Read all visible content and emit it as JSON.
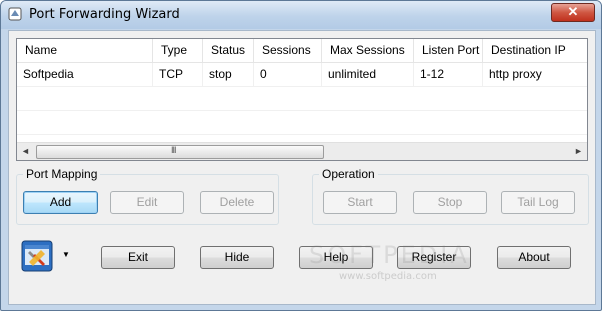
{
  "window": {
    "title": "Port Forwarding Wizard",
    "close_glyph": "✕"
  },
  "table": {
    "columns": [
      "Name",
      "Type",
      "Status",
      "Sessions",
      "Max Sessions",
      "Listen Port",
      "Destination IP"
    ],
    "rows": [
      [
        "Softpedia",
        "TCP",
        "stop",
        "0",
        "unlimited",
        "1-12",
        "http proxy"
      ]
    ],
    "scroll": {
      "left_arrow": "◄",
      "right_arrow": "►",
      "grip": "III"
    }
  },
  "port_mapping": {
    "label": "Port Mapping",
    "add": "Add",
    "edit": "Edit",
    "delete": "Delete"
  },
  "operation": {
    "label": "Operation",
    "start": "Start",
    "stop": "Stop",
    "tail_log": "Tail Log"
  },
  "bottom": {
    "dropdown_glyph": "▼",
    "exit": "Exit",
    "hide": "Hide",
    "help": "Help",
    "register": "Register",
    "about": "About"
  },
  "watermark": {
    "text": "SOFTPEDIA",
    "sub": "www.softpedia.com"
  },
  "colors": {
    "accent": "#3c7fb1",
    "close": "#c0311e",
    "title_bar": "#bed3ea"
  },
  "icons": {
    "app": "app-icon",
    "tools": "tools-icon"
  }
}
